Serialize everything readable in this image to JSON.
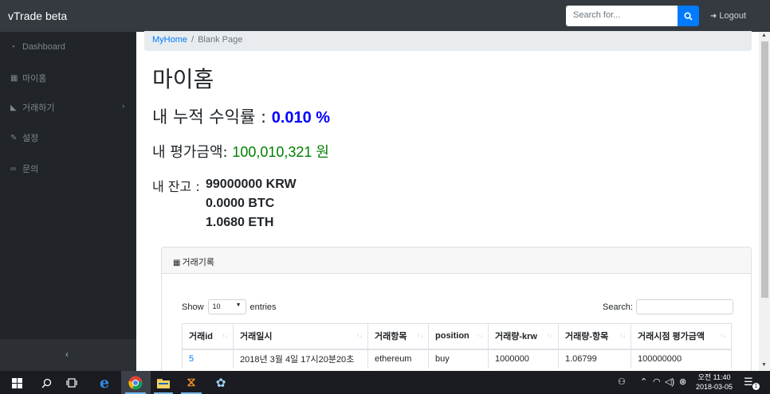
{
  "app": {
    "brand": "vTrade beta"
  },
  "header": {
    "search_placeholder": "Search for...",
    "logout_label": "Logout"
  },
  "sidebar": {
    "items": [
      {
        "label": "Dashboard",
        "icon": "dashboard-icon"
      },
      {
        "label": "마이홈",
        "icon": "table-icon"
      },
      {
        "label": "거래하기",
        "icon": "area-chart-icon"
      },
      {
        "label": "설정",
        "icon": "wrench-icon"
      },
      {
        "label": "문의",
        "icon": "link-icon"
      }
    ],
    "collapse_glyph": "‹"
  },
  "breadcrumb": {
    "home": "MyHome",
    "separator": "/",
    "current": "Blank Page"
  },
  "page": {
    "title": "마이홈",
    "profit_label": "내 누적 수익률 : ",
    "profit_value": "0.010 %",
    "valuation_label": "내 평가금액: ",
    "valuation_value": "100,010,321 원",
    "balance_label": "내 잔고 : ",
    "balances": [
      "99000000 KRW",
      "0.0000 BTC",
      "1.0680 ETH"
    ]
  },
  "trade_card": {
    "title": "거래기록",
    "show_label": "Show",
    "entries_value": "10",
    "entries_label": "entries",
    "search_label": "Search:",
    "columns": [
      "거래id",
      "거래일시",
      "거래항목",
      "position",
      "거래량-krw",
      "거래량-항목",
      "거래시점 평가금액"
    ],
    "rows": [
      [
        "5",
        "2018년 3월 4일 17시20분20초",
        "ethereum",
        "buy",
        "1000000",
        "1.06799",
        "100000000"
      ]
    ]
  },
  "taskbar": {
    "clock_time": "오전 11:40",
    "clock_date": "2018-03-05",
    "notification_count": "1"
  }
}
